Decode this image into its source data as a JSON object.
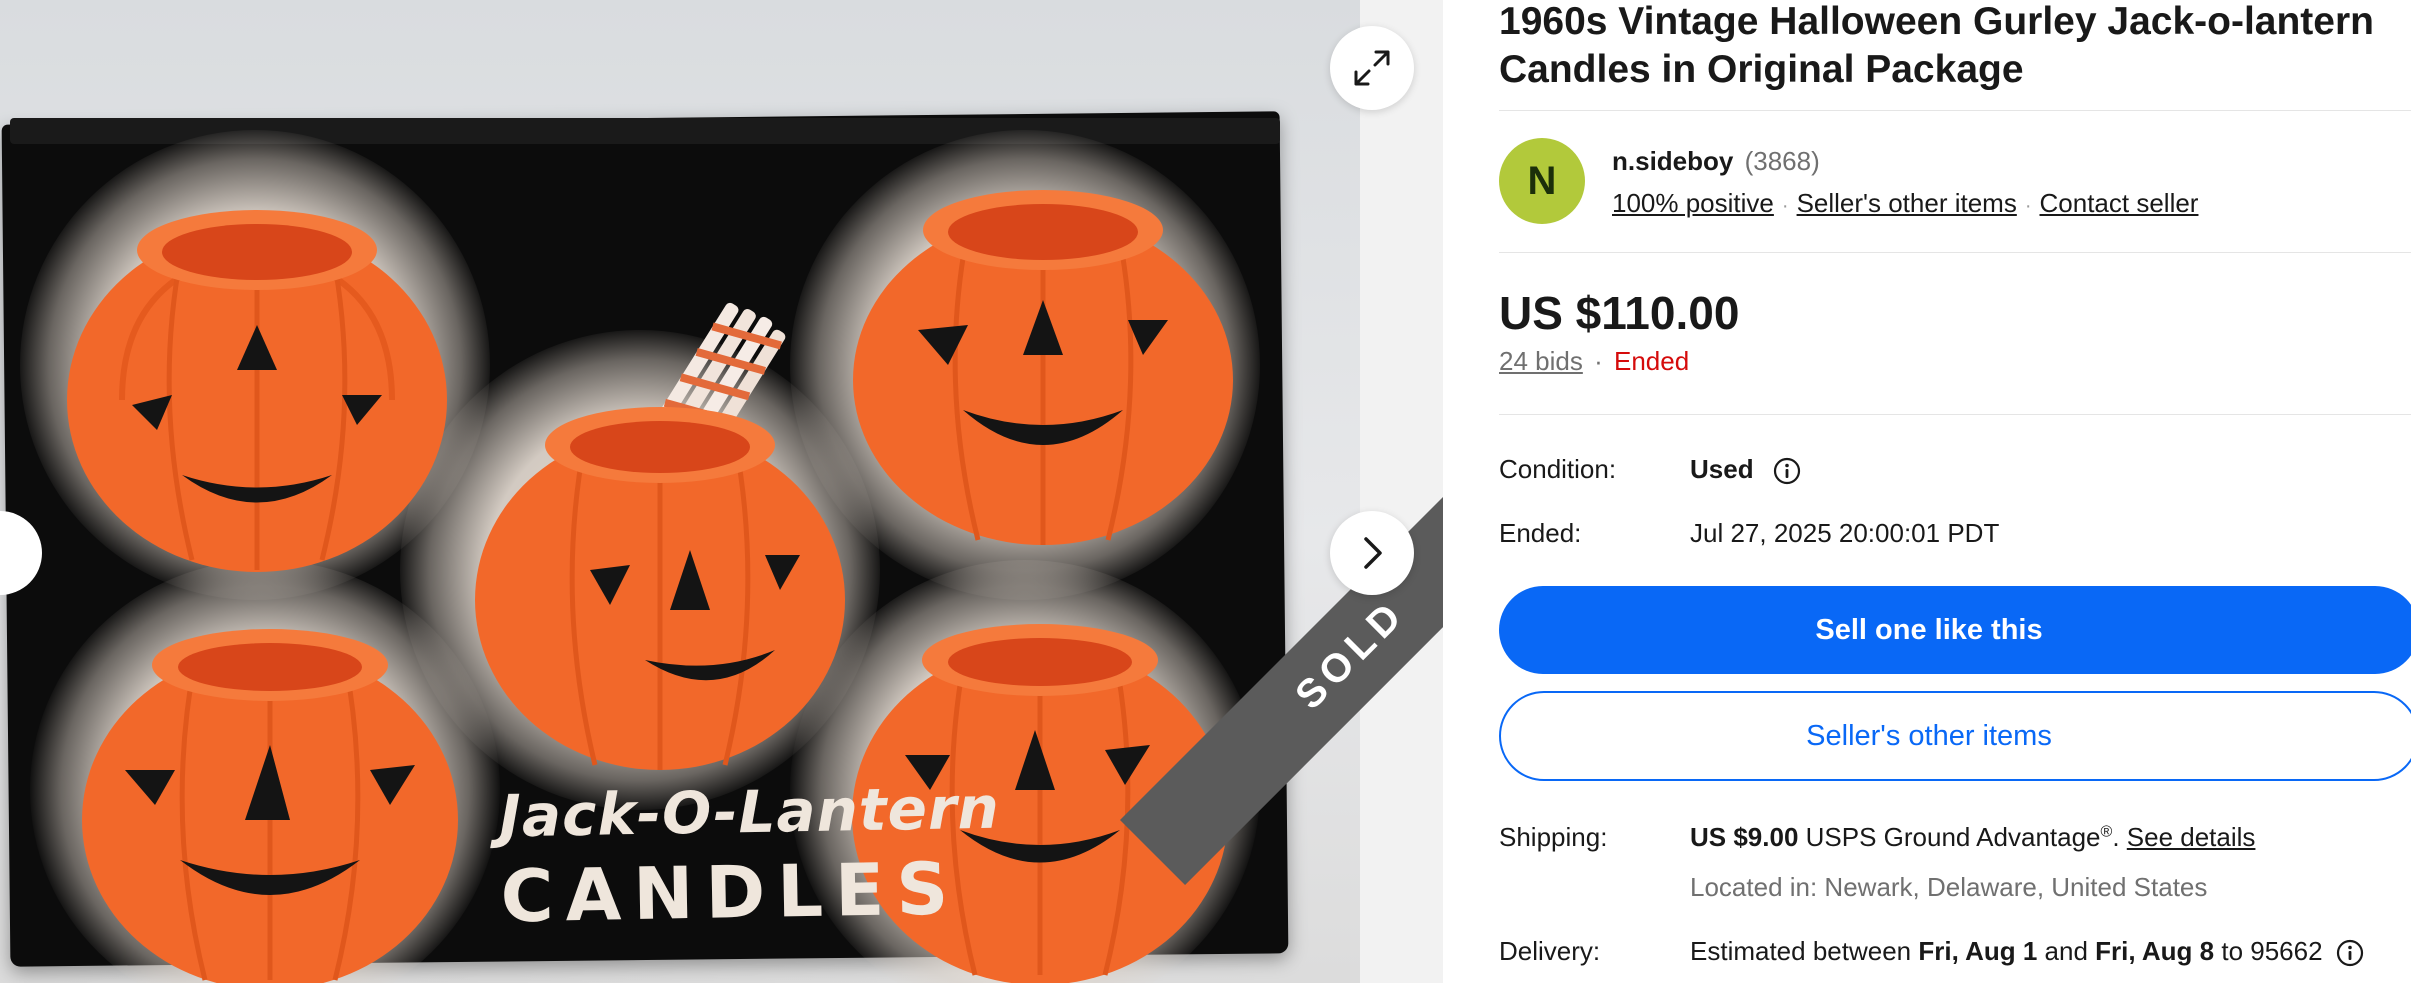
{
  "gallery": {
    "brand_line1": "Jack-O-Lantern",
    "brand_line2": "CANDLES",
    "sold_label": "SOLD",
    "expand_icon": "expand-icon",
    "next_icon": "chevron-right-icon"
  },
  "listing": {
    "title_line1": "1960s Vintage Halloween Gurley Jack-o-lantern",
    "title_line2": "Candles in Original Package"
  },
  "seller": {
    "avatar_initial": "N",
    "name": "n.sideboy",
    "feedback_count": "(3868)",
    "positive": "100% positive",
    "other_items_link": "Seller's other items",
    "contact_link": "Contact seller"
  },
  "pricing": {
    "price": "US $110.00",
    "bids": "24 bids",
    "separator": "·",
    "status": "Ended"
  },
  "details": {
    "condition_label": "Condition:",
    "condition_value": "Used",
    "ended_label": "Ended:",
    "ended_value": "Jul 27, 2025 20:00:01 PDT"
  },
  "actions": {
    "primary": "Sell one like this",
    "secondary": "Seller's other items"
  },
  "shipping": {
    "label": "Shipping:",
    "price": "US $9.00",
    "service": "USPS Ground Advantage",
    "registered": "®",
    "period": ".",
    "see_details": "See details",
    "location": "Located in: Newark, Delaware, United States"
  },
  "delivery": {
    "label": "Delivery:",
    "prefix": "Estimated between",
    "start": "Fri, Aug 1",
    "and": "and",
    "end": "Fri, Aug 8",
    "to": "to",
    "zip": "95662"
  },
  "colors": {
    "accent": "#0968f6",
    "ended": "#d50b0b",
    "avatar": "#b2c93b",
    "pumpkin": "#f2682a"
  }
}
